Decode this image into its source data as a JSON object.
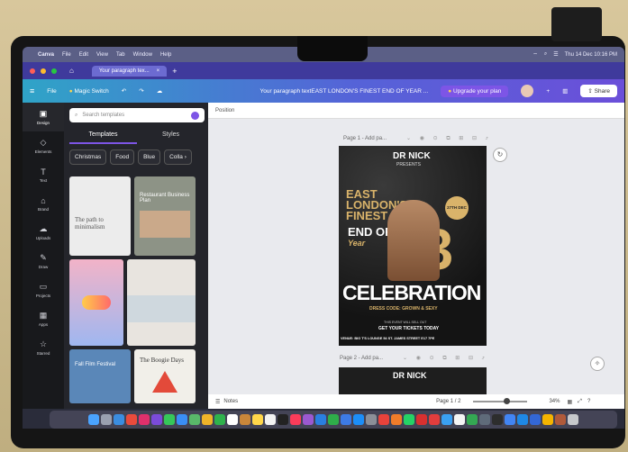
{
  "menubar": {
    "app": "Canva",
    "items": [
      "File",
      "Edit",
      "View",
      "Tab",
      "Window",
      "Help"
    ],
    "clock": "Thu 14 Dec 10:16 PM"
  },
  "browser": {
    "tab_title": "Your paragraph tex..."
  },
  "toolbar": {
    "file": "File",
    "magic_switch": "Magic Switch",
    "doc_title": "Your paragraph textEAST LONDON'S FINEST END OF YEAR ...",
    "upgrade": "Upgrade your plan",
    "share": "Share"
  },
  "sidebar": {
    "items": [
      {
        "label": "Design",
        "icon": "layout-icon"
      },
      {
        "label": "Elements",
        "icon": "elements-icon"
      },
      {
        "label": "Text",
        "icon": "text-icon"
      },
      {
        "label": "Brand",
        "icon": "brand-icon"
      },
      {
        "label": "Uploads",
        "icon": "cloud-upload-icon"
      },
      {
        "label": "Draw",
        "icon": "draw-icon"
      },
      {
        "label": "Projects",
        "icon": "folder-icon"
      },
      {
        "label": "Apps",
        "icon": "apps-icon"
      },
      {
        "label": "Starred",
        "icon": "star-icon"
      }
    ]
  },
  "panel": {
    "search_placeholder": "Search templates",
    "tabs": [
      "Templates",
      "Styles"
    ],
    "chips": [
      "Christmas",
      "Food",
      "Blue",
      "Colla"
    ],
    "thumbs": [
      {
        "text": "The path to minimalism"
      },
      {
        "text": "Restaurant Business Plan"
      },
      {
        "text": ""
      },
      {
        "text": ""
      },
      {
        "text": "Fall Film Festival"
      },
      {
        "text": "The Boogie Days"
      }
    ]
  },
  "canvas": {
    "position_label": "Position",
    "page1_label": "Page 1 - Add pa...",
    "page2_label": "Page 2 - Add pa...",
    "poster": {
      "brand": "DR NICK",
      "brand_sub": "PRESENTS",
      "headline_1": "EAST",
      "headline_2": "LONDON'S",
      "headline_3": "FINEST",
      "headline_4": "END OF",
      "headline_5": "Year",
      "year": "23",
      "badge": "27TH DEC",
      "celebration": "CELEBRATION",
      "dress_code": "DRESS CODE: GROWN & SEXY",
      "tickets_small": "THIS EVENT WILL SELL OUT",
      "tickets": "GET YOUR TICKETS TODAY",
      "venue": "VENUE: BIG T'S LOUNGE 54 ST. JAMES STREET E17 7PE"
    }
  },
  "status": {
    "notes": "Notes",
    "page_count": "Page 1 / 2",
    "zoom": "34%"
  }
}
